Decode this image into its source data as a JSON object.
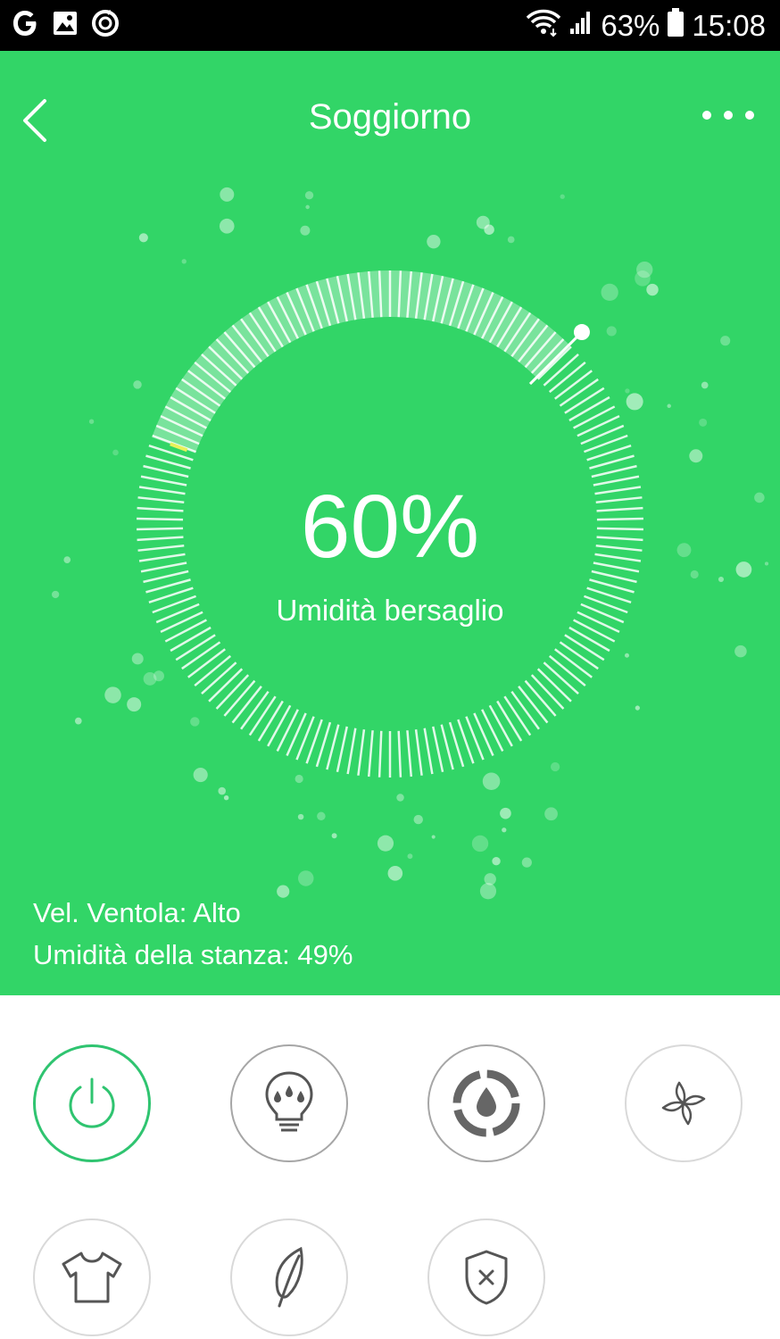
{
  "status_bar": {
    "left_icons": [
      "google-icon",
      "image-icon",
      "sync-icon"
    ],
    "battery_percent": "63%",
    "time": "15:08"
  },
  "header": {
    "title": "Soggiorno",
    "back_icon": "back-arrow-icon",
    "more_icon": "more-dots-icon"
  },
  "dial": {
    "target_value": "60%",
    "target_label": "Umidità bersaglio",
    "level_fraction": 0.6
  },
  "info": {
    "fan_speed": "Vel. Ventola: Alto",
    "room_humidity": "Umidità della stanza: 49%"
  },
  "controls": [
    {
      "icon": "power-icon",
      "active": true
    },
    {
      "icon": "light-bulb-icon",
      "active": false
    },
    {
      "icon": "humidity-mode-icon",
      "active": false
    },
    {
      "icon": "fan-icon",
      "active": false
    },
    {
      "icon": "clothes-dry-icon",
      "active": false
    },
    {
      "icon": "leaf-eco-icon",
      "active": false
    },
    {
      "icon": "shield-filter-icon",
      "active": false
    }
  ],
  "colors": {
    "background": "#32d567",
    "accent_ring": "#2fc470",
    "status_bar": "#000000"
  }
}
